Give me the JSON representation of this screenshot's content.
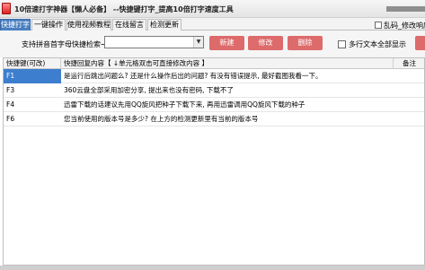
{
  "window": {
    "title": "10倍速打字神器【懒人必备】 --快捷键打字_提高10倍打字速度工具",
    "icon": "app-icon"
  },
  "tabs": [
    {
      "label": "快捷打字",
      "active": true
    },
    {
      "label": "一键操作",
      "active": false
    },
    {
      "label": "使用视频教程",
      "active": false
    },
    {
      "label": "在线留言",
      "active": false
    },
    {
      "label": "检测更新",
      "active": false
    }
  ],
  "top_option": {
    "label": "乱码_修改响应"
  },
  "toolbar": {
    "hint": "支持拼音首字母快捷检索→",
    "search_value": "",
    "new_label": "新建",
    "edit_label": "修改",
    "delete_label": "删除",
    "multiline_label": "多行文本全部显示",
    "colors": {
      "button": "#dd6b6b",
      "selection": "#3d7ecf"
    }
  },
  "table": {
    "columns": [
      "快捷键(可改)",
      "快捷回复内容【 ↓单元格双击可直接修改内容 】",
      "备注"
    ],
    "rows": [
      {
        "key": "F1",
        "content": "是运行后跳出问题么? 还是什么操作后出的问题? 有没有错误提示, 最好截图我看一下。",
        "note": "",
        "selected": true
      },
      {
        "key": "F3",
        "content": "360云盘全部采用加密分享, 提出来也没有密码, 下载不了",
        "note": "",
        "selected": false
      },
      {
        "key": "F4",
        "content": "迅雷下载的话建议先用QQ旋风把种子下载下来, 再用迅雷调用QQ旋风下载的种子",
        "note": "",
        "selected": false
      },
      {
        "key": "F6",
        "content": "您当前使用的版本号是多少? 在上方的检测更新里有当前的版本号",
        "note": "",
        "selected": false
      }
    ]
  }
}
